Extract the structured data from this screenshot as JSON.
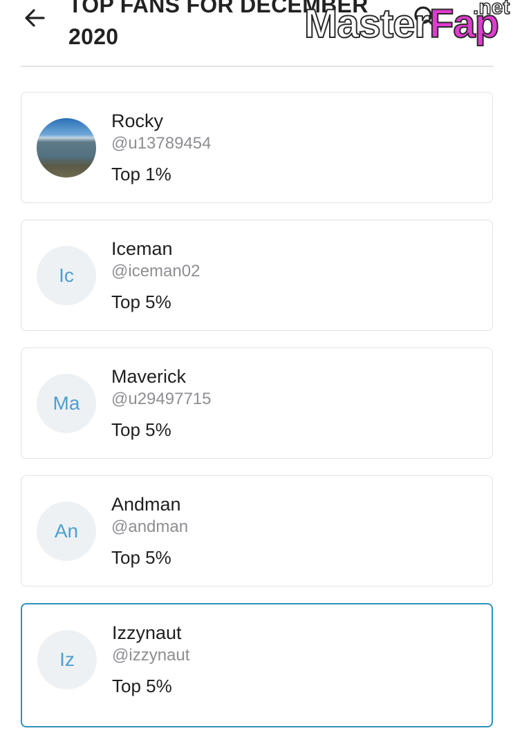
{
  "header": {
    "title_line1": "TOP FANS FOR DECEMBER",
    "title_line2": "2020",
    "back_icon": "arrow-left-icon",
    "search_icon": "search-icon"
  },
  "watermark": {
    "main": "Master",
    "accent": "Fap",
    "tld": ".net"
  },
  "fans": [
    {
      "name": "Rocky",
      "handle": "@u13789454",
      "rank": "Top 1%",
      "avatar_text": ""
    },
    {
      "name": "Iceman",
      "handle": "@iceman02",
      "rank": "Top 5%",
      "avatar_text": "Ic"
    },
    {
      "name": "Maverick",
      "handle": "@u29497715",
      "rank": "Top 5%",
      "avatar_text": "Ma"
    },
    {
      "name": "Andman",
      "handle": "@andman",
      "rank": "Top 5%",
      "avatar_text": "An"
    },
    {
      "name": "Izzynaut",
      "handle": "@izzynaut",
      "rank": "Top 5%",
      "avatar_text": "Iz"
    }
  ],
  "colors": {
    "accent": "#2d90ba",
    "initials": "#4d9fcf",
    "handle": "#8e8e93"
  }
}
